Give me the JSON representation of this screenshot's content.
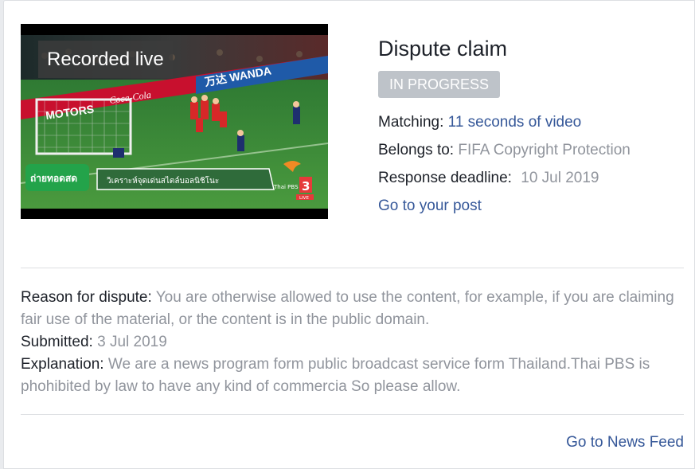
{
  "video": {
    "badge": "Recorded live",
    "overlay_sign": "ถ่ายทอดสด",
    "overlay_caption": "วิเคราะห์จุดเด่นสไตล์บอลนิชิโนะ",
    "channel_name": "Thai PBS",
    "channel_number": "3",
    "live_label": "LIVE",
    "ad_board_1": "MOTORS",
    "ad_board_2": "Coca-Cola",
    "ad_board_3": "万达 WANDA"
  },
  "claim": {
    "title": "Dispute claim",
    "status": "IN PROGRESS",
    "matching_label": "Matching:",
    "matching_value": "11 seconds of video",
    "belongs_label": "Belongs to:",
    "belongs_value": "FIFA Copyright Protection",
    "deadline_label": "Response deadline:",
    "deadline_value": "10 Jul 2019",
    "post_link": "Go to your post"
  },
  "details": {
    "reason_label": "Reason for dispute:",
    "reason_value": "You are otherwise allowed to use the content, for example, if you are claiming fair use of the material, or the content is in the public domain.",
    "submitted_label": "Submitted:",
    "submitted_value": "3 Jul 2019",
    "explanation_label": "Explanation:",
    "explanation_value": "We are a news program form public broadcast service form Thailand.Thai PBS is phohibited by law to have any kind of commercia So please allow."
  },
  "footer": {
    "news_feed_link": "Go to News Feed"
  },
  "colors": {
    "link": "#365899",
    "muted": "#90949c",
    "status_bg": "#bec3c9",
    "pitch": "#3f8b3a"
  }
}
